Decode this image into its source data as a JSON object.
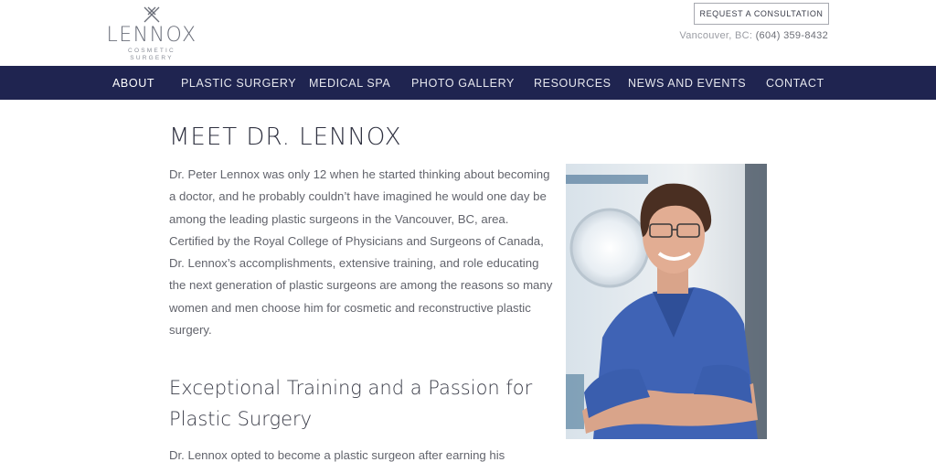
{
  "header": {
    "logo": {
      "wordmark": "LENNOX",
      "subtitle": "COSMETIC SURGERY"
    },
    "cta_label": "REQUEST A CONSULTATION",
    "location": "Vancouver, BC:",
    "phone": "(604) 359-8432"
  },
  "nav": {
    "items": [
      {
        "label": "ABOUT",
        "active": true
      },
      {
        "label": "PLASTIC SURGERY",
        "active": false
      },
      {
        "label": "MEDICAL SPA",
        "active": false
      },
      {
        "label": "PHOTO GALLERY",
        "active": false
      },
      {
        "label": "RESOURCES",
        "active": false
      },
      {
        "label": "NEWS AND EVENTS",
        "active": false
      },
      {
        "label": "CONTACT",
        "active": false
      }
    ]
  },
  "main": {
    "title": "MEET DR. LENNOX",
    "intro": "Dr. Peter Lennox was only 12 when he started thinking about becoming a doctor, and he probably couldn’t have imagined he would one day be among the leading plastic surgeons in the Vancouver, BC, area. Certified by the Royal College of Physicians and Surgeons of Canada, Dr. Lennox’s accomplishments, extensive training, and role educating the next generation of plastic surgeons are among the reasons so many women and men choose him for cosmetic and reconstructive plastic surgery.",
    "subheading": "Exceptional Training and a Passion for Plastic Surgery",
    "paragraph2": "Dr. Lennox opted to become a plastic surgeon after earning his"
  },
  "colors": {
    "nav_bg": "#1f2450",
    "scrubs": "#3f63b5"
  }
}
